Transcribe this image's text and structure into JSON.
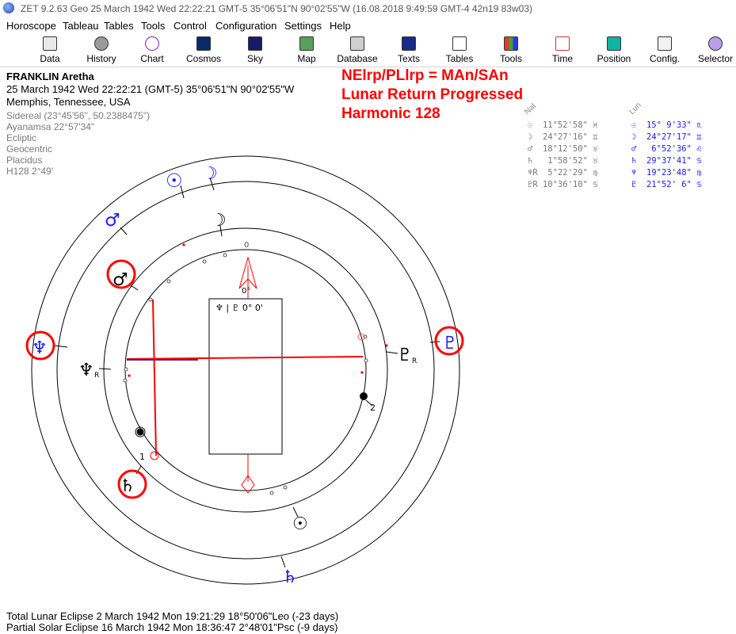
{
  "window": {
    "title": "ZET 9.2.63 Geo   25 March 1942  Wed  22:22:21 GMT-5 35°06'51\"N  90°02'55\"W  (16.08.2018   9:49:59 GMT-4 42n19 83w03)"
  },
  "menu": [
    "Horoscope",
    "Tableau",
    "Tables",
    "Tools",
    "Control",
    "Configuration",
    "Settings",
    "Help"
  ],
  "toolbar": [
    {
      "label": "Data",
      "icon": "data-icon"
    },
    {
      "label": "History",
      "icon": "history-icon"
    },
    {
      "label": "Chart",
      "icon": "chart-icon"
    },
    {
      "label": "Cosmos",
      "icon": "cosmos-icon"
    },
    {
      "label": "Sky",
      "icon": "sky-icon"
    },
    {
      "label": "Map",
      "icon": "map-icon"
    },
    {
      "label": "Database",
      "icon": "database-icon"
    },
    {
      "label": "Texts",
      "icon": "texts-icon"
    },
    {
      "label": "Tables",
      "icon": "tables-icon"
    },
    {
      "label": "Tools",
      "icon": "tools-icon"
    },
    {
      "label": "Time",
      "icon": "time-icon"
    },
    {
      "label": "Position",
      "icon": "position-icon"
    },
    {
      "label": "Config.",
      "icon": "config-icon"
    },
    {
      "label": "Selector",
      "icon": "selector-icon"
    }
  ],
  "header": {
    "name": "FRANKLIN Aretha",
    "datetime": "25 March 1942  Wed  22:22:21 (GMT-5) 35°06'51\"N  90°02'55\"W",
    "place": "Memphis, Tennessee, USA"
  },
  "settings": [
    "Sidereal (23°45'56\", 50.2388475\")",
    "Ayanamsa 22°57'34\"",
    "Ecliptic",
    "Geocentric",
    "Placidus",
    "H128   2°49'"
  ],
  "formula": {
    "line1": "NElrp/PLlrp = MAn/SAn",
    "line2": "Lunar Return Progressed",
    "line3": "Harmonic 128"
  },
  "columns": {
    "natal": "Nat",
    "lunar": "Lun"
  },
  "natal_positions": [
    {
      "planet": "☉",
      "value": "11°52'58\"",
      "sign": "♓"
    },
    {
      "planet": "☽",
      "value": "24°27'16\"",
      "sign": "♊"
    },
    {
      "planet": "♂",
      "value": "18°12'50\"",
      "sign": "♉"
    },
    {
      "planet": "♄",
      "value": " 1°58'52\"",
      "sign": "♉"
    },
    {
      "planet": "♆R",
      "value": " 5°22'29\"",
      "sign": "♍"
    },
    {
      "planet": "♇R",
      "value": "10°36'10\"",
      "sign": "♋"
    }
  ],
  "lunar_positions": [
    {
      "planet": "☉",
      "value": "15° 9'33\"",
      "sign": "♏"
    },
    {
      "planet": "☽",
      "value": "24°27'17\"",
      "sign": "♊"
    },
    {
      "planet": "♂",
      "value": " 6°52'36\"",
      "sign": "♌"
    },
    {
      "planet": "♄",
      "value": "29°37'41\"",
      "sign": "♋"
    },
    {
      "planet": "♆",
      "value": "19°23'48\"",
      "sign": "♍"
    },
    {
      "planet": "♇",
      "value": "21°52' 6\"",
      "sign": "♋"
    }
  ],
  "chart": {
    "center_box": "♆ | ♇   0° 0'",
    "top_marker": "0°",
    "labels": {
      "one": "1",
      "two": "2",
      "zero": "0"
    },
    "glyphs": {
      "sun": "☉",
      "moon": "☽",
      "mars": "♂",
      "saturn": "♄",
      "neptune": "♆",
      "pluto": "♇",
      "retro": "R"
    }
  },
  "colors": {
    "red": "#ff0000",
    "blue": "#1a1aff",
    "black": "#000000",
    "gray": "#777777"
  },
  "eclipses": [
    "Total Lunar Eclipse 2 March 1942 Mon 19:21:29 18°50'06\"Leo (-23 days)",
    "Partial Solar Eclipse 16 March 1942 Mon 18:36:47  2°48'01\"Psc (-9 days)"
  ]
}
